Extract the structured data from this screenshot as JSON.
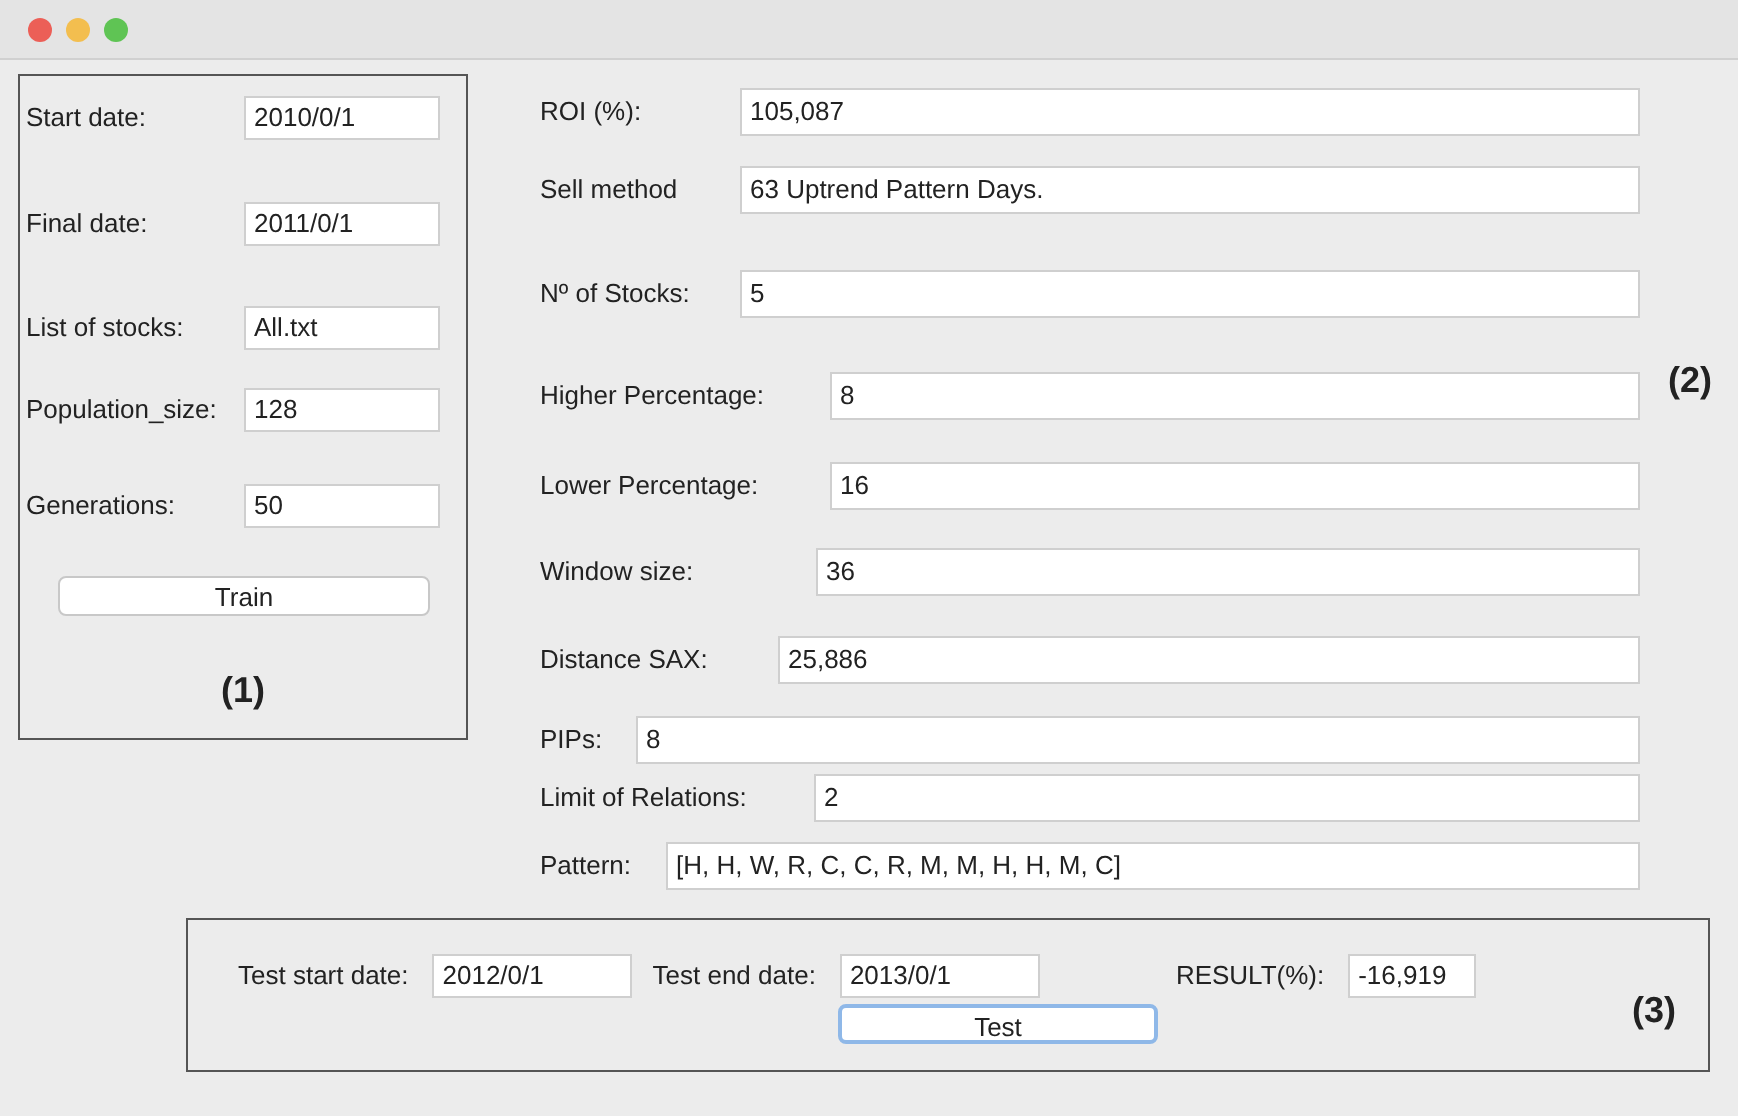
{
  "window": {
    "controls": [
      {
        "color": "#ec5f57"
      },
      {
        "color": "#f3be4f"
      },
      {
        "color": "#5fc454"
      }
    ]
  },
  "train_panel": {
    "fields": [
      {
        "label": "Start date:",
        "value": "2010/0/1"
      },
      {
        "label": "Final date:",
        "value": "2011/0/1"
      },
      {
        "label": "List of stocks:",
        "value": "All.txt"
      },
      {
        "label": "Population_size:",
        "value": "128"
      },
      {
        "label": "Generations:",
        "value": "50"
      }
    ],
    "button": "Train",
    "marker": "(1)"
  },
  "results_panel": {
    "fields": [
      {
        "label": "ROI (%):",
        "value": "105,087"
      },
      {
        "label": "Sell method",
        "value": "63 Uptrend Pattern Days."
      },
      {
        "label": "Nº of Stocks:",
        "value": "5"
      },
      {
        "label": "Higher Percentage:",
        "value": "8"
      },
      {
        "label": "Lower Percentage:",
        "value": "16"
      },
      {
        "label": "Window size:",
        "value": "36"
      },
      {
        "label": "Distance SAX:",
        "value": "25,886"
      },
      {
        "label": "PIPs:",
        "value": "8"
      },
      {
        "label": "Limit of Relations:",
        "value": "2"
      },
      {
        "label": "Pattern:",
        "value": "[H, H, W, R, C, C, R, M, M, H, H, M, C]"
      }
    ],
    "marker": "(2)"
  },
  "test_panel": {
    "fields": [
      {
        "label": "Test start date:",
        "value": "2012/0/1"
      },
      {
        "label": "Test end date:",
        "value": "2013/0/1"
      },
      {
        "label": "RESULT(%):",
        "value": "-16,919"
      }
    ],
    "button": "Test",
    "marker": "(3)"
  }
}
